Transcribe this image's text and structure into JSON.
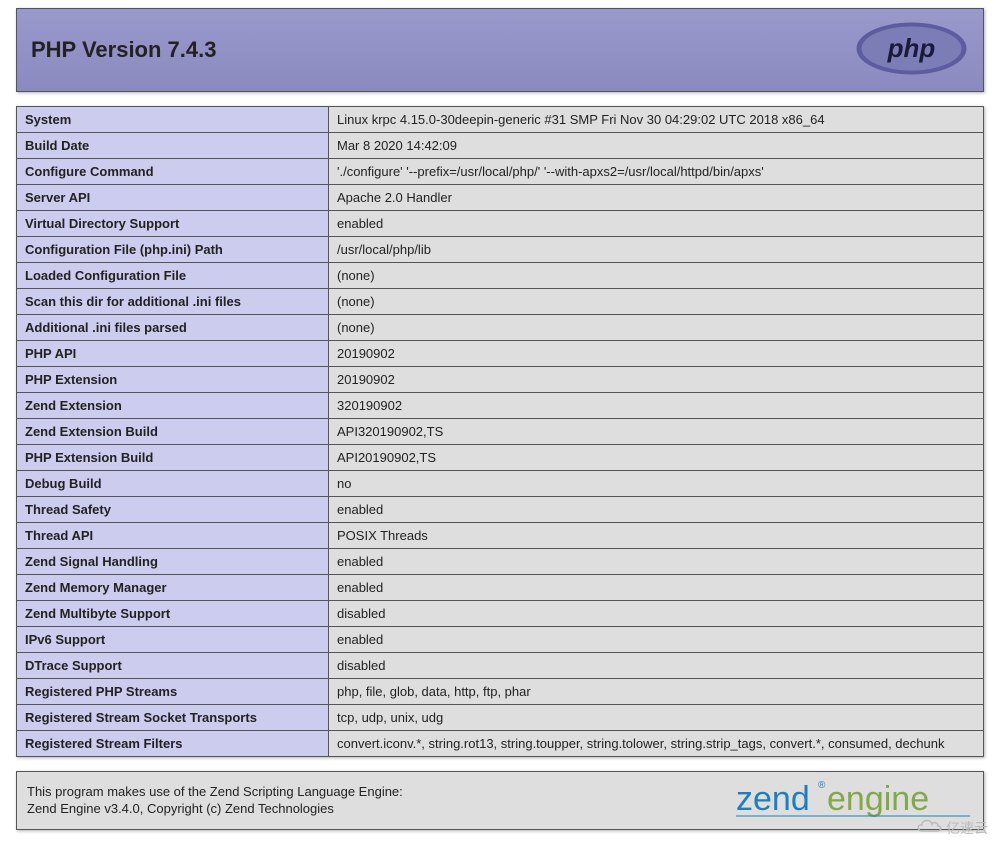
{
  "header": {
    "title": "PHP Version 7.4.3"
  },
  "rows": [
    {
      "k": "System",
      "v": "Linux krpc 4.15.0-30deepin-generic #31 SMP Fri Nov 30 04:29:02 UTC 2018 x86_64"
    },
    {
      "k": "Build Date",
      "v": "Mar 8 2020 14:42:09"
    },
    {
      "k": "Configure Command",
      "v": "'./configure' '--prefix=/usr/local/php/' '--with-apxs2=/usr/local/httpd/bin/apxs'"
    },
    {
      "k": "Server API",
      "v": "Apache 2.0 Handler"
    },
    {
      "k": "Virtual Directory Support",
      "v": "enabled"
    },
    {
      "k": "Configuration File (php.ini) Path",
      "v": "/usr/local/php/lib"
    },
    {
      "k": "Loaded Configuration File",
      "v": "(none)"
    },
    {
      "k": "Scan this dir for additional .ini files",
      "v": "(none)"
    },
    {
      "k": "Additional .ini files parsed",
      "v": "(none)"
    },
    {
      "k": "PHP API",
      "v": "20190902"
    },
    {
      "k": "PHP Extension",
      "v": "20190902"
    },
    {
      "k": "Zend Extension",
      "v": "320190902"
    },
    {
      "k": "Zend Extension Build",
      "v": "API320190902,TS"
    },
    {
      "k": "PHP Extension Build",
      "v": "API20190902,TS"
    },
    {
      "k": "Debug Build",
      "v": "no"
    },
    {
      "k": "Thread Safety",
      "v": "enabled"
    },
    {
      "k": "Thread API",
      "v": "POSIX Threads"
    },
    {
      "k": "Zend Signal Handling",
      "v": "enabled"
    },
    {
      "k": "Zend Memory Manager",
      "v": "enabled"
    },
    {
      "k": "Zend Multibyte Support",
      "v": "disabled"
    },
    {
      "k": "IPv6 Support",
      "v": "enabled"
    },
    {
      "k": "DTrace Support",
      "v": "disabled"
    },
    {
      "k": "Registered PHP Streams",
      "v": "php, file, glob, data, http, ftp, phar"
    },
    {
      "k": "Registered Stream Socket Transports",
      "v": "tcp, udp, unix, udg"
    },
    {
      "k": "Registered Stream Filters",
      "v": "convert.iconv.*, string.rot13, string.toupper, string.tolower, string.strip_tags, convert.*, consumed, dechunk"
    }
  ],
  "zend": {
    "line1": "This program makes use of the Zend Scripting Language Engine:",
    "line2": "Zend Engine v3.4.0, Copyright (c) Zend Technologies"
  },
  "watermark": "亿速云"
}
